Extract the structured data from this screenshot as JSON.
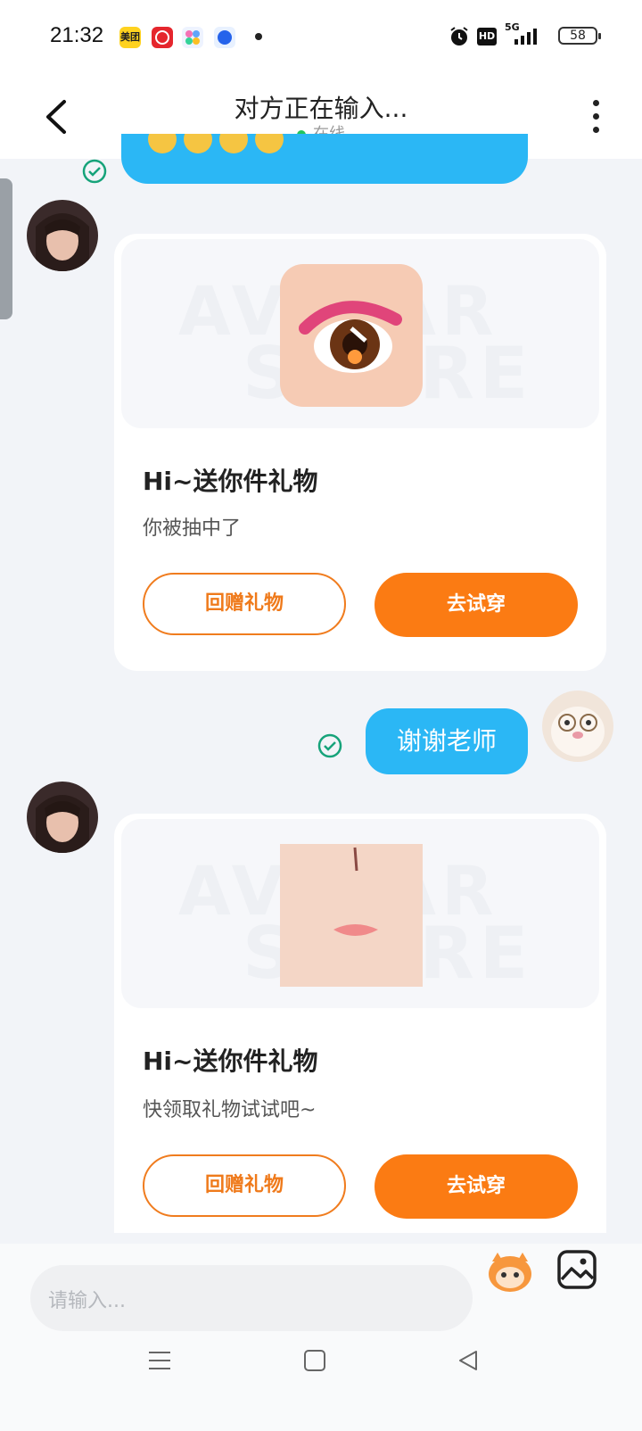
{
  "status_bar": {
    "time": "21:32",
    "apps": [
      "meituan-icon",
      "app-icon-red",
      "app-icon-multicolor",
      "app-icon-blue"
    ],
    "network": "5G",
    "hd": "HD",
    "battery": "58"
  },
  "header": {
    "title": "对方正在输入...",
    "status": "在线"
  },
  "messages": [
    {
      "watermark_top": "AVATAR",
      "watermark_bottom": "STORE",
      "title": "Hi~送你件礼物",
      "subtitle": "你被抽中了",
      "button_left": "回赠礼物",
      "button_right": "去试穿"
    },
    {
      "text": "谢谢老师"
    },
    {
      "watermark_top": "AVATAR",
      "watermark_bottom": "STORE",
      "title": "Hi~送你件礼物",
      "subtitle": "快领取礼物试试吧~",
      "button_left": "回赠礼物",
      "button_right": "去试穿"
    }
  ],
  "input": {
    "placeholder": "请输入..."
  },
  "colors": {
    "accent_orange": "#fb7b13",
    "bubble_blue": "#2bb7f5",
    "online_green": "#22c55e",
    "read_check": "#16a37a"
  }
}
